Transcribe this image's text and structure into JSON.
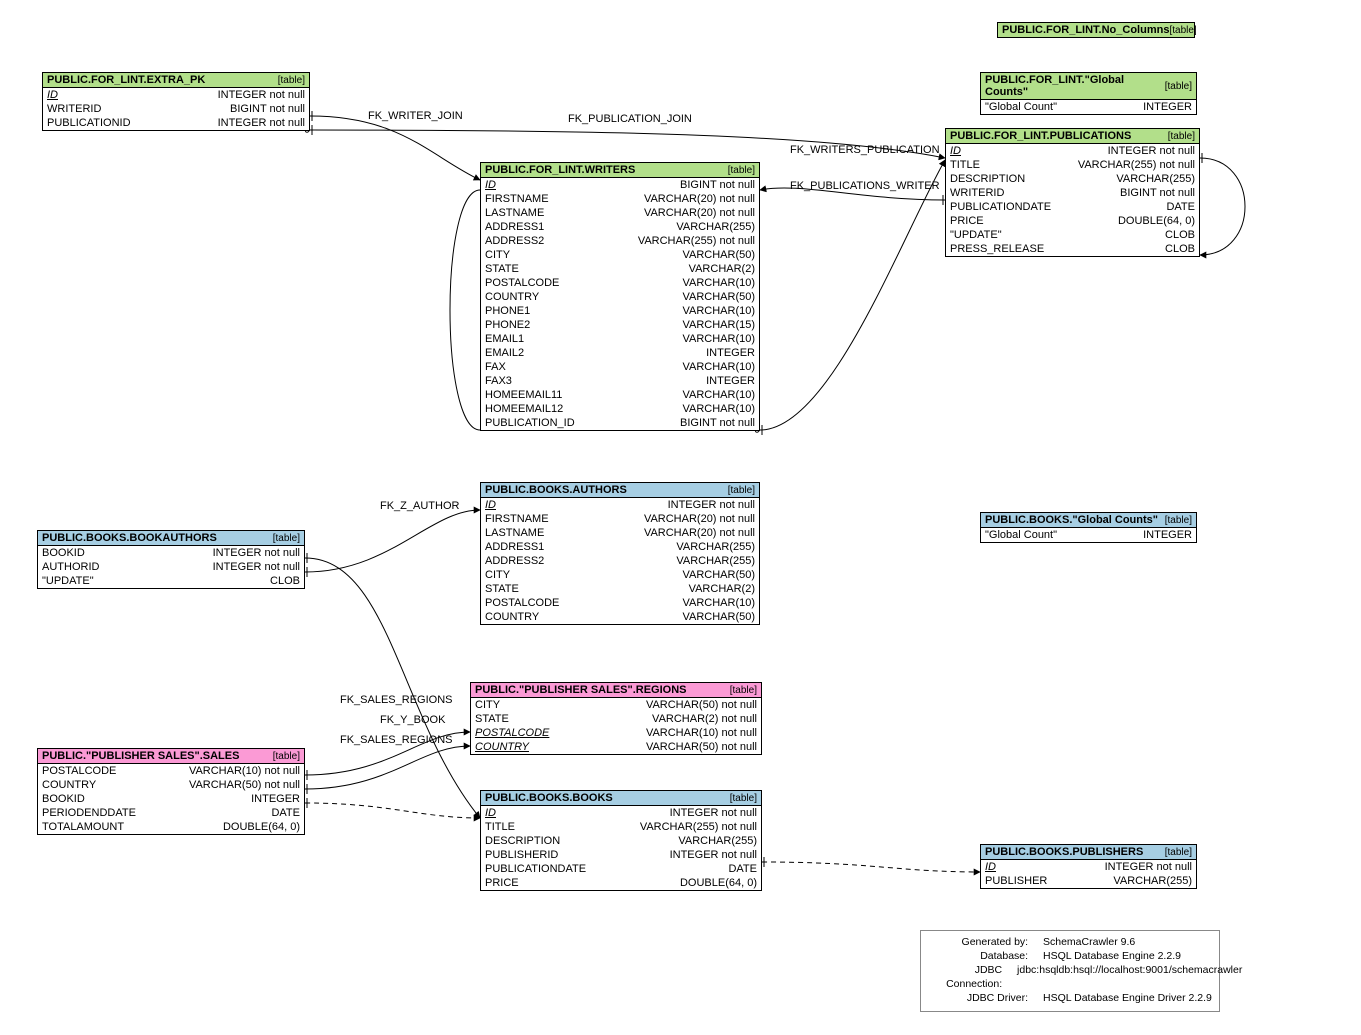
{
  "colors": {
    "green": "#b2df8a",
    "blue": "#a6cee3",
    "pink": "#fb9ad5"
  },
  "tables": {
    "no_columns": {
      "title": "PUBLIC.FOR_LINT.No_Columns",
      "tag": "[table]",
      "columns": []
    },
    "for_lint_global": {
      "title": "PUBLIC.FOR_LINT.\"Global Counts\"",
      "tag": "[table]",
      "columns": [
        {
          "n": "\"Global Count\"",
          "t": "INTEGER"
        }
      ]
    },
    "extra_pk": {
      "title": "PUBLIC.FOR_LINT.EXTRA_PK",
      "tag": "[table]",
      "columns": [
        {
          "n": "ID",
          "t": "INTEGER not null",
          "pk": true
        },
        {
          "n": "WRITERID",
          "t": "BIGINT not null"
        },
        {
          "n": "PUBLICATIONID",
          "t": "INTEGER not null"
        }
      ]
    },
    "publications": {
      "title": "PUBLIC.FOR_LINT.PUBLICATIONS",
      "tag": "[table]",
      "columns": [
        {
          "n": "ID",
          "t": "INTEGER not null",
          "pk": true
        },
        {
          "n": "TITLE",
          "t": "VARCHAR(255) not null"
        },
        {
          "n": "DESCRIPTION",
          "t": "VARCHAR(255)"
        },
        {
          "n": "WRITERID",
          "t": "BIGINT not null"
        },
        {
          "n": "PUBLICATIONDATE",
          "t": "DATE"
        },
        {
          "n": "PRICE",
          "t": "DOUBLE(64, 0)"
        },
        {
          "n": "\"UPDATE\"",
          "t": "CLOB"
        },
        {
          "n": "PRESS_RELEASE",
          "t": "CLOB"
        }
      ]
    },
    "writers": {
      "title": "PUBLIC.FOR_LINT.WRITERS",
      "tag": "[table]",
      "columns": [
        {
          "n": "ID",
          "t": "BIGINT not null",
          "pk": true
        },
        {
          "n": "FIRSTNAME",
          "t": "VARCHAR(20) not null"
        },
        {
          "n": "LASTNAME",
          "t": "VARCHAR(20) not null"
        },
        {
          "n": "ADDRESS1",
          "t": "VARCHAR(255)"
        },
        {
          "n": "ADDRESS2",
          "t": "VARCHAR(255) not null"
        },
        {
          "n": "CITY",
          "t": "VARCHAR(50)"
        },
        {
          "n": "STATE",
          "t": "VARCHAR(2)"
        },
        {
          "n": "POSTALCODE",
          "t": "VARCHAR(10)"
        },
        {
          "n": "COUNTRY",
          "t": "VARCHAR(50)"
        },
        {
          "n": "PHONE1",
          "t": "VARCHAR(10)"
        },
        {
          "n": "PHONE2",
          "t": "VARCHAR(15)"
        },
        {
          "n": "EMAIL1",
          "t": "VARCHAR(10)"
        },
        {
          "n": "EMAIL2",
          "t": "INTEGER"
        },
        {
          "n": "FAX",
          "t": "VARCHAR(10)"
        },
        {
          "n": "FAX3",
          "t": "INTEGER"
        },
        {
          "n": "HOMEEMAIL11",
          "t": "VARCHAR(10)"
        },
        {
          "n": "HOMEEMAIL12",
          "t": "VARCHAR(10)"
        },
        {
          "n": "PUBLICATION_ID",
          "t": "BIGINT not null"
        }
      ]
    },
    "authors": {
      "title": "PUBLIC.BOOKS.AUTHORS",
      "tag": "[table]",
      "columns": [
        {
          "n": "ID",
          "t": "INTEGER not null",
          "pk": true
        },
        {
          "n": "FIRSTNAME",
          "t": "VARCHAR(20) not null"
        },
        {
          "n": "LASTNAME",
          "t": "VARCHAR(20) not null"
        },
        {
          "n": "ADDRESS1",
          "t": "VARCHAR(255)"
        },
        {
          "n": "ADDRESS2",
          "t": "VARCHAR(255)"
        },
        {
          "n": "CITY",
          "t": "VARCHAR(50)"
        },
        {
          "n": "STATE",
          "t": "VARCHAR(2)"
        },
        {
          "n": "POSTALCODE",
          "t": "VARCHAR(10)"
        },
        {
          "n": "COUNTRY",
          "t": "VARCHAR(50)"
        }
      ]
    },
    "books_global": {
      "title": "PUBLIC.BOOKS.\"Global Counts\"",
      "tag": "[table]",
      "columns": [
        {
          "n": "\"Global Count\"",
          "t": "INTEGER"
        }
      ]
    },
    "bookauthors": {
      "title": "PUBLIC.BOOKS.BOOKAUTHORS",
      "tag": "[table]",
      "columns": [
        {
          "n": "BOOKID",
          "t": "INTEGER not null"
        },
        {
          "n": "AUTHORID",
          "t": "INTEGER not null"
        },
        {
          "n": "\"UPDATE\"",
          "t": "CLOB"
        }
      ]
    },
    "regions": {
      "title": "PUBLIC.\"PUBLISHER SALES\".REGIONS",
      "tag": "[table]",
      "columns": [
        {
          "n": "CITY",
          "t": "VARCHAR(50) not null"
        },
        {
          "n": "STATE",
          "t": "VARCHAR(2) not null"
        },
        {
          "n": "POSTALCODE",
          "t": "VARCHAR(10) not null",
          "pk": true
        },
        {
          "n": "COUNTRY",
          "t": "VARCHAR(50) not null",
          "pk": true
        }
      ]
    },
    "sales": {
      "title": "PUBLIC.\"PUBLISHER SALES\".SALES",
      "tag": "[table]",
      "columns": [
        {
          "n": "POSTALCODE",
          "t": "VARCHAR(10) not null"
        },
        {
          "n": "COUNTRY",
          "t": "VARCHAR(50) not null"
        },
        {
          "n": "BOOKID",
          "t": "INTEGER"
        },
        {
          "n": "PERIODENDDATE",
          "t": "DATE"
        },
        {
          "n": "TOTALAMOUNT",
          "t": "DOUBLE(64, 0)"
        }
      ]
    },
    "books": {
      "title": "PUBLIC.BOOKS.BOOKS",
      "tag": "[table]",
      "columns": [
        {
          "n": "ID",
          "t": "INTEGER not null",
          "pk": true
        },
        {
          "n": "TITLE",
          "t": "VARCHAR(255) not null"
        },
        {
          "n": "DESCRIPTION",
          "t": "VARCHAR(255)"
        },
        {
          "n": "PUBLISHERID",
          "t": "INTEGER not null"
        },
        {
          "n": "PUBLICATIONDATE",
          "t": "DATE"
        },
        {
          "n": "PRICE",
          "t": "DOUBLE(64, 0)"
        }
      ]
    },
    "publishers": {
      "title": "PUBLIC.BOOKS.PUBLISHERS",
      "tag": "[table]",
      "columns": [
        {
          "n": "ID",
          "t": "INTEGER not null",
          "pk": true
        },
        {
          "n": "PUBLISHER",
          "t": "VARCHAR(255)"
        }
      ]
    }
  },
  "edge_labels": {
    "fk_writer_join": "FK_WRITER_JOIN",
    "fk_publication_join": "FK_PUBLICATION_JOIN",
    "fk_writers_pub": "FK_WRITERS_PUBLICATION",
    "fk_pubs_writer": "FK_PUBLICATIONS_WRITER",
    "fk_z_author": "FK_Z_AUTHOR",
    "fk_sales_regions": "FK_SALES_REGIONS",
    "fk_y_book": "FK_Y_BOOK",
    "fk_sales_regions2": "FK_SALES_REGIONS"
  },
  "meta": {
    "generated_by_k": "Generated by:",
    "generated_by_v": "SchemaCrawler 9.6",
    "database_k": "Database:",
    "database_v": "HSQL Database Engine  2.2.9",
    "conn_k": "JDBC Connection:",
    "conn_v": "jdbc:hsqldb:hsql://localhost:9001/schemacrawler",
    "driver_k": "JDBC Driver:",
    "driver_v": "HSQL Database Engine Driver  2.2.9"
  }
}
